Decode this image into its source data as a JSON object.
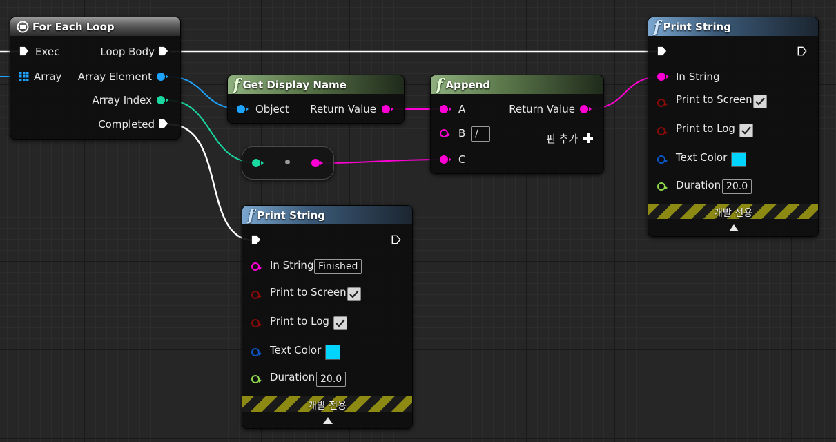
{
  "colors": {
    "exec": "#ffffff",
    "object_pin": "#1ea4ff",
    "int_pin": "#19d9a0",
    "string_pin": "#ff00d4",
    "bool_pin": "#8a0a0a",
    "color_pin": "#0a56c8",
    "float_pin": "#8fd94a",
    "text_color_swatch": "#00d4ff"
  },
  "for_each_loop": {
    "title": "For Each Loop",
    "pins": {
      "exec": "Exec",
      "array": "Array",
      "loop_body": "Loop Body",
      "array_element": "Array Element",
      "array_index": "Array Index",
      "completed": "Completed"
    }
  },
  "get_display_name": {
    "title": "Get Display Name",
    "object": "Object",
    "return_value": "Return Value"
  },
  "append": {
    "title": "Append",
    "a": "A",
    "b": "B",
    "b_value": "/",
    "c": "C",
    "return_value": "Return Value",
    "add_pin": "핀 추가",
    "add_pin_icon": "plus-icon"
  },
  "print_string_top": {
    "title": "Print String",
    "in_string": "In String",
    "print_to_screen": "Print to Screen",
    "print_to_screen_checked": true,
    "print_to_log": "Print to Log",
    "print_to_log_checked": true,
    "text_color": "Text Color",
    "duration": "Duration",
    "duration_value": "20.0",
    "dev_only": "개발 전용"
  },
  "print_string_bottom": {
    "title": "Print String",
    "in_string": "In String",
    "in_string_value": "Finished",
    "print_to_screen": "Print to Screen",
    "print_to_screen_checked": true,
    "print_to_log": "Print to Log",
    "print_to_log_checked": true,
    "text_color": "Text Color",
    "duration": "Duration",
    "duration_value": "20.0",
    "dev_only": "개발 전용"
  }
}
